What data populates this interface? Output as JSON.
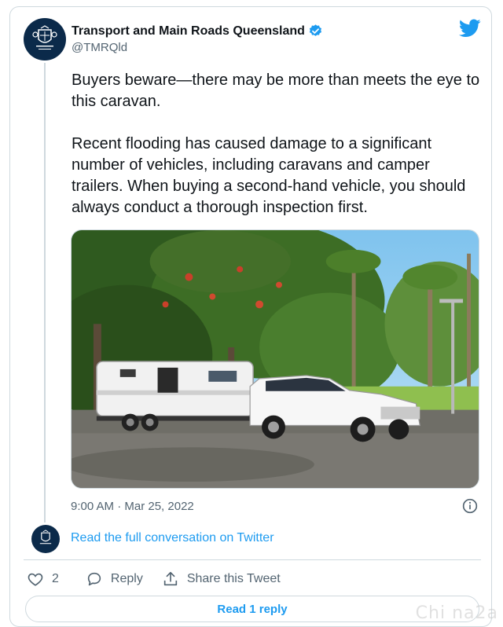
{
  "account": {
    "name": "Transport and Main Roads Queensland",
    "handle": "@TMRQld",
    "avatar_text": "Queensland Government"
  },
  "tweet": {
    "text": "Buyers beware—there may be more than meets the eye to this caravan.\n\nRecent flooding has caused damage to a significant number of vehicles, including caravans and camper trailers. When buying a second-hand vehicle, you should always conduct a thorough inspection first.",
    "timestamp": "9:00 AM · Mar 25, 2022"
  },
  "conversation": {
    "read_full_label": "Read the full conversation on Twitter"
  },
  "actions": {
    "like_count": "2",
    "reply_label": "Reply",
    "share_label": "Share this Tweet"
  },
  "footer": {
    "read_reply_label": "Read 1 reply"
  },
  "watermark": "Chi na2a",
  "icons": {
    "verified": "verified-badge-icon",
    "brand": "twitter-bird-icon",
    "info": "info-icon",
    "like": "heart-icon",
    "reply": "speech-bubble-icon",
    "share": "share-upload-icon"
  },
  "colors": {
    "accent": "#1d9bf0",
    "text": "#0f1419",
    "muted": "#536471",
    "border": "#cfd9de",
    "avatar_bg": "#0b2a4a"
  }
}
